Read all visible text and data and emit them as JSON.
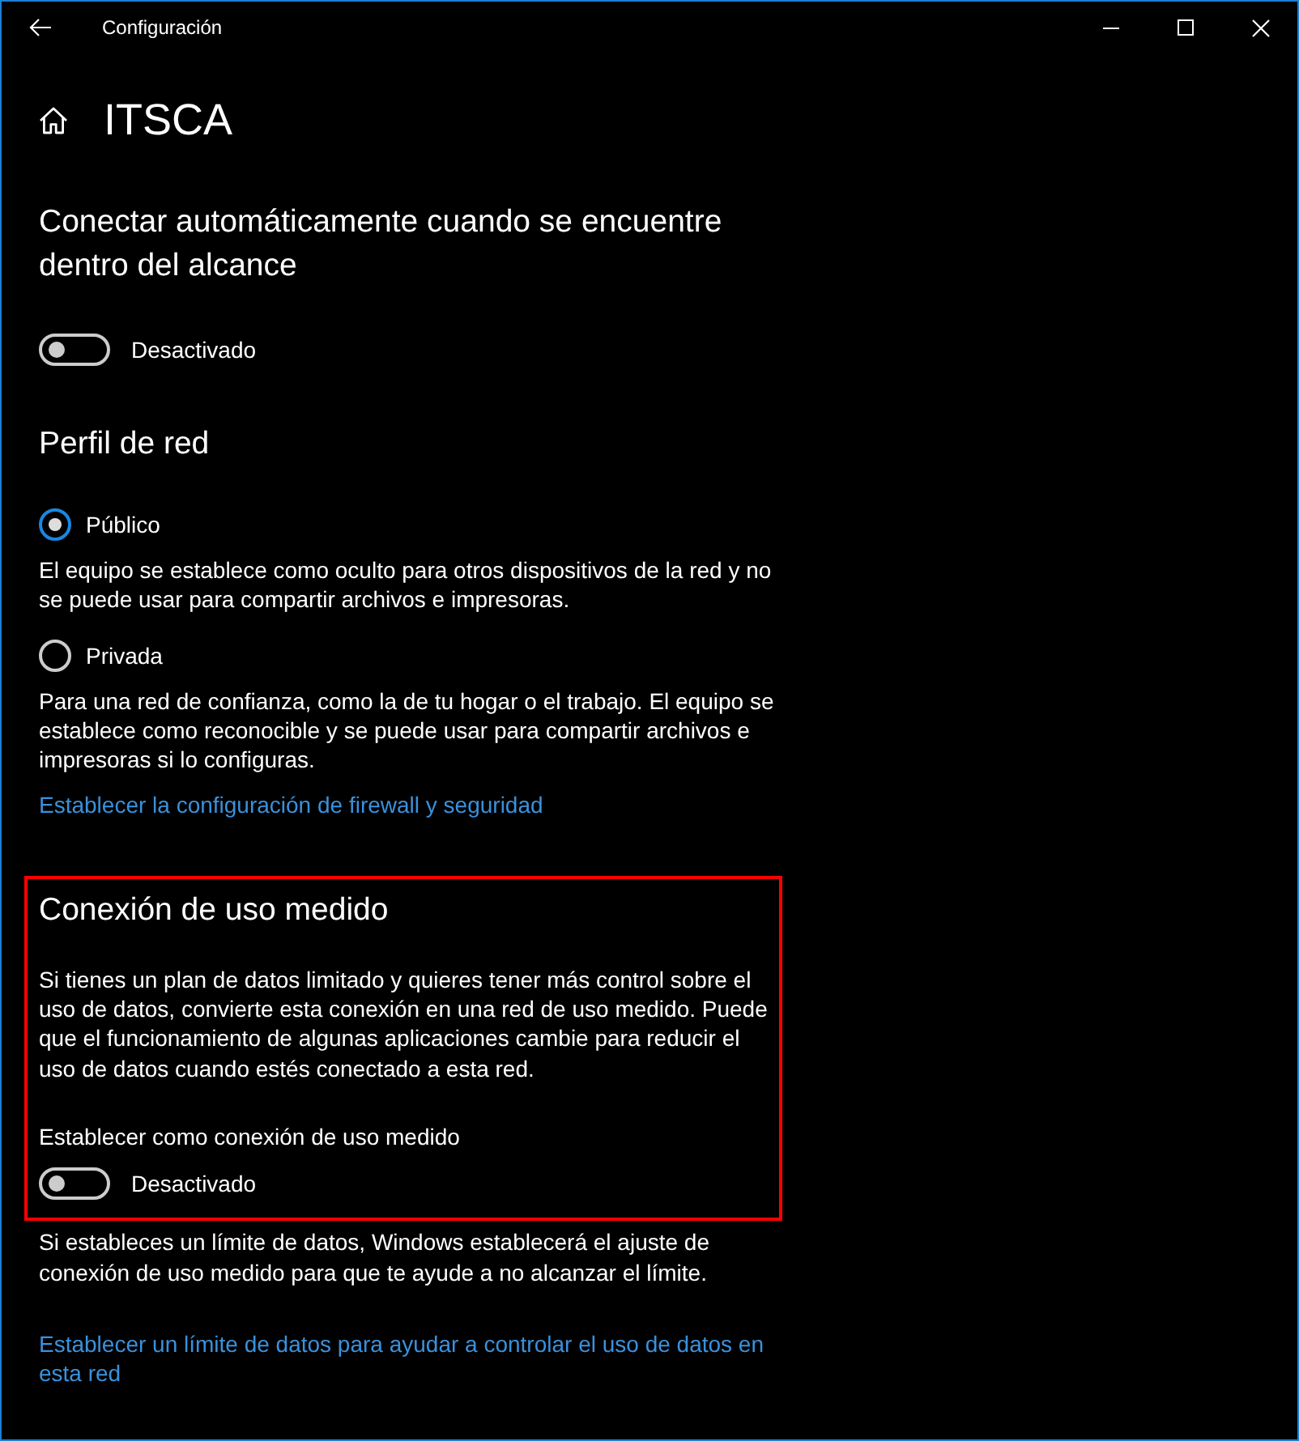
{
  "window": {
    "title": "Configuración"
  },
  "page": {
    "title": "ITSCA"
  },
  "auto_connect": {
    "heading": "Conectar automáticamente cuando se encuentre dentro del alcance",
    "toggle": {
      "on": false,
      "label": "Desactivado"
    }
  },
  "network_profile": {
    "heading": "Perfil de red",
    "options": [
      {
        "label": "Público",
        "selected": true,
        "description": "El equipo se establece como oculto para otros dispositivos de la red y no se puede usar para compartir archivos e impresoras."
      },
      {
        "label": "Privada",
        "selected": false,
        "description": "Para una red de confianza, como la de tu hogar o el trabajo. El equipo se establece como reconocible y se puede usar para compartir archivos e impresoras si lo configuras."
      }
    ],
    "link": "Establecer la configuración de firewall y seguridad"
  },
  "metered_connection": {
    "highlighted": true,
    "heading": "Conexión de uso medido",
    "description": "Si tienes un plan de datos limitado y quieres tener más control sobre el uso de datos, convierte esta conexión en una red de uso medido. Puede que el funcionamiento de algunas aplicaciones cambie para reducir el uso de datos cuando estés conectado a esta red.",
    "toggle_caption": "Establecer como conexión de uso medido",
    "toggle": {
      "on": false,
      "label": "Desactivado"
    },
    "note": "Si estableces un límite de datos, Windows establecerá el ajuste de conexión de uso medido para que te ayude a no alcanzar el límite.",
    "link": "Establecer un límite de datos para ayudar a controlar el uso de datos en esta red"
  }
}
